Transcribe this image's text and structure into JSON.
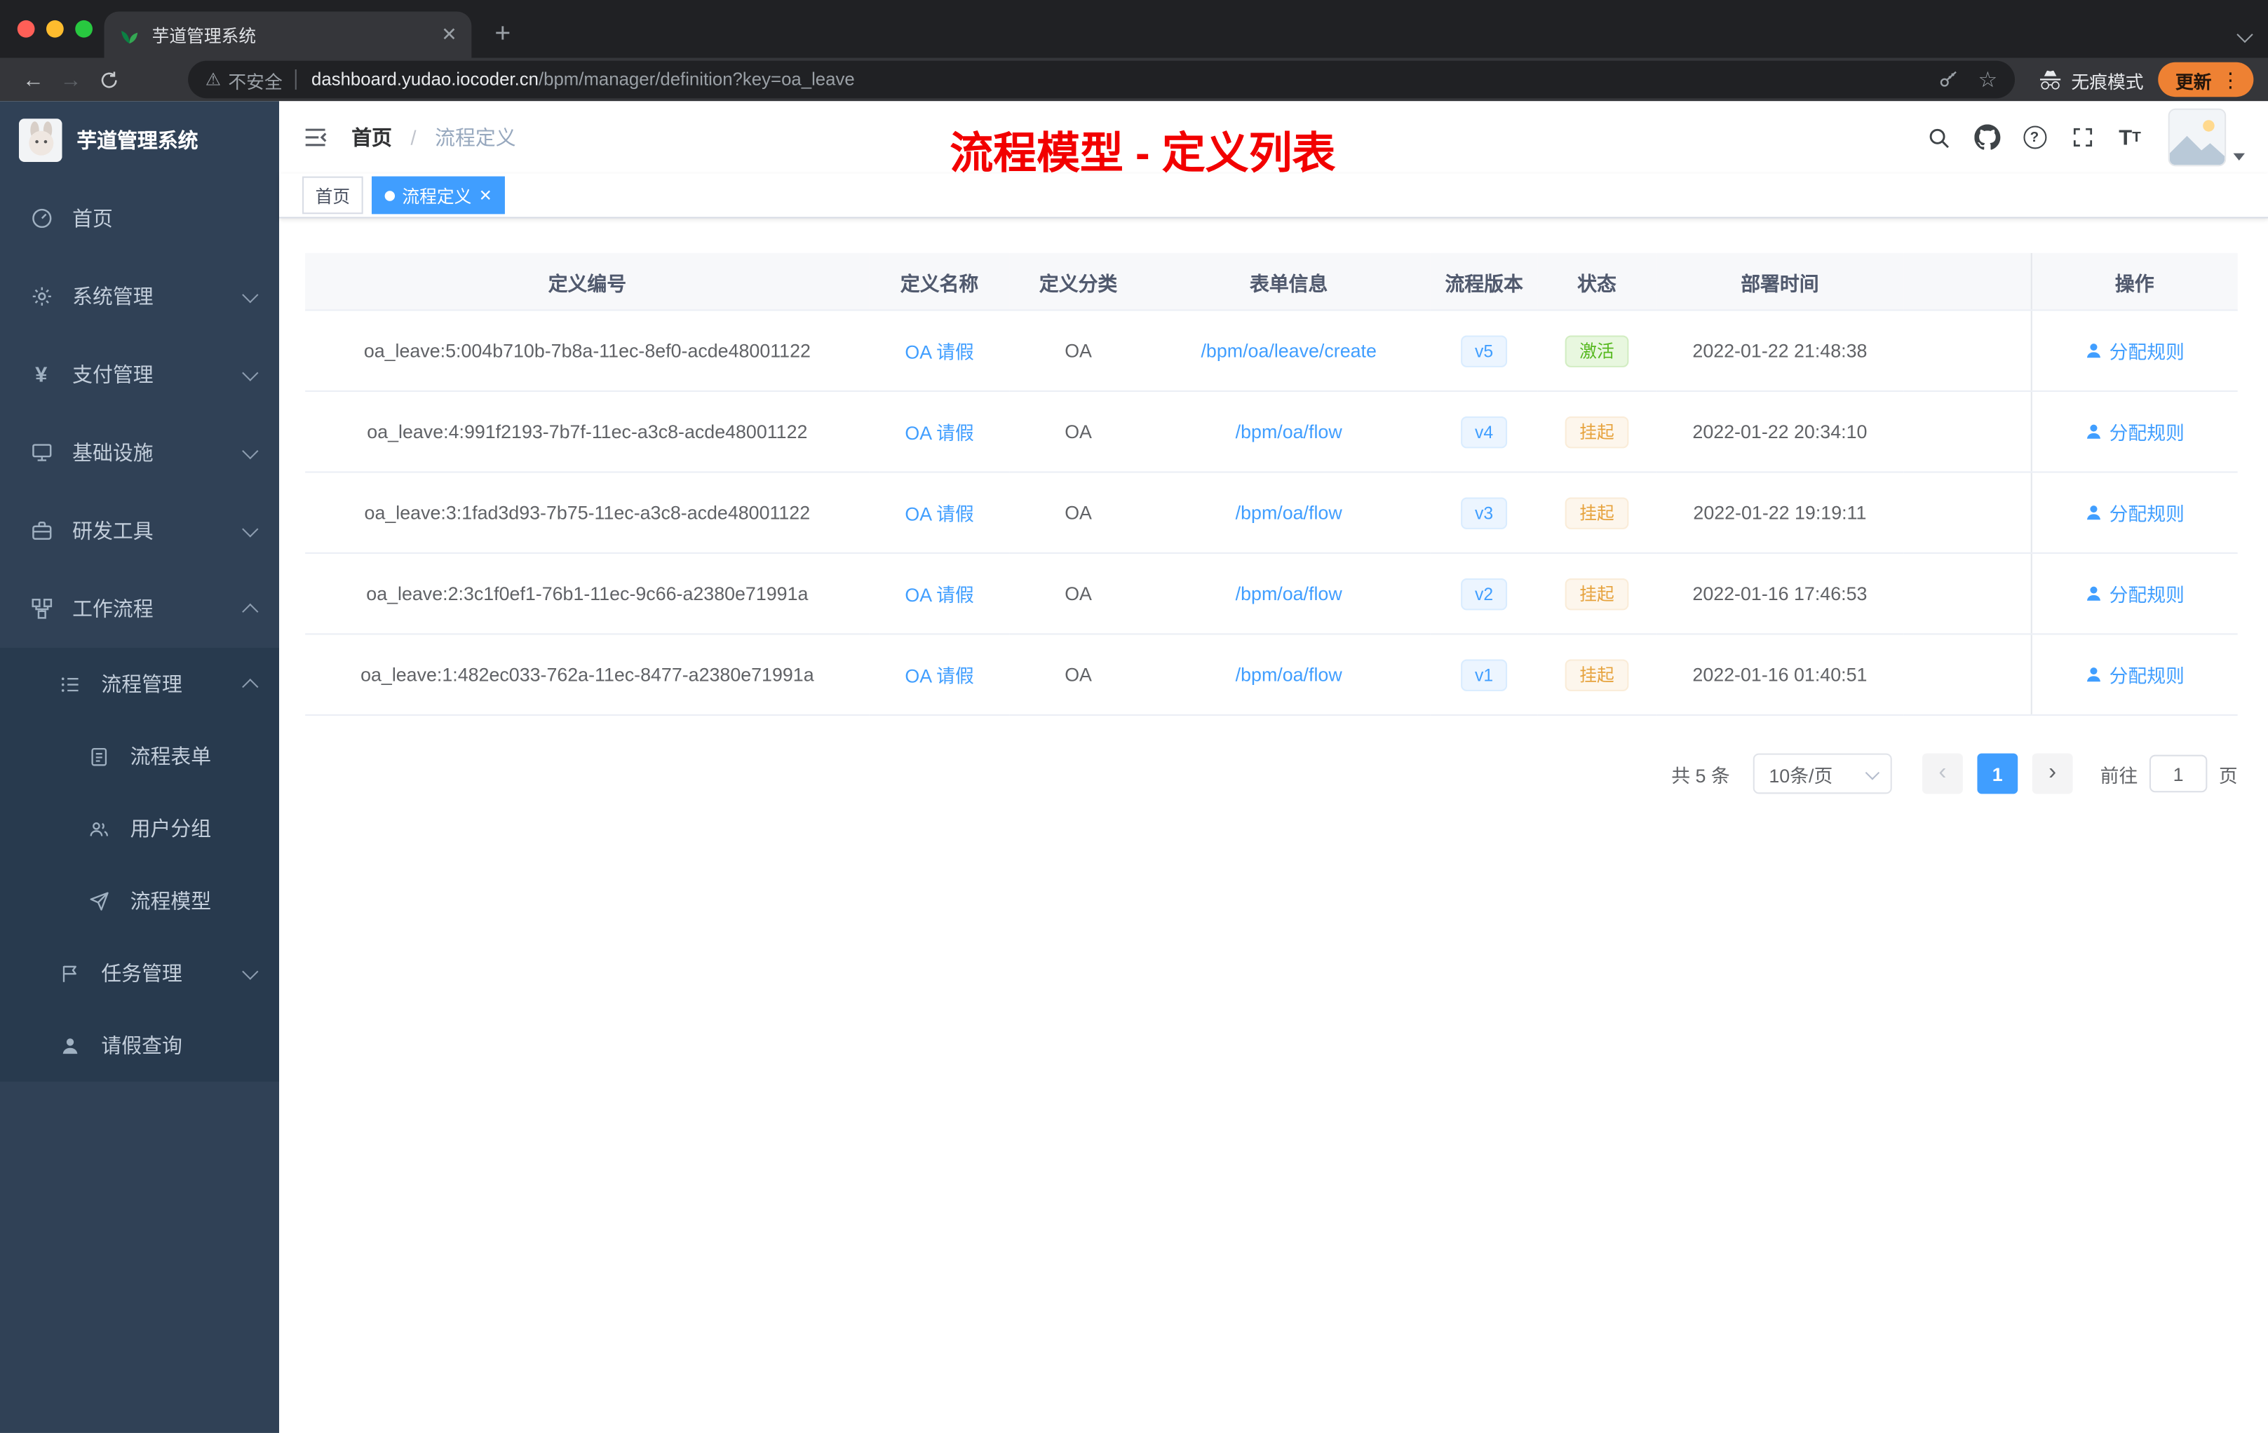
{
  "browser": {
    "tab_title": "芋道管理系统",
    "security_label": "不安全",
    "url_host": "dashboard.yudao.iocoder.cn",
    "url_path": "/bpm/manager/definition?key=oa_leave",
    "incognito_label": "无痕模式",
    "update_label": "更新"
  },
  "sidebar": {
    "logo_title": "芋道管理系统",
    "menu": [
      {
        "label": "首页",
        "icon": "dashboard-icon"
      },
      {
        "label": "系统管理",
        "icon": "gear-icon"
      },
      {
        "label": "支付管理",
        "icon": "yen-icon"
      },
      {
        "label": "基础设施",
        "icon": "infrastructure-icon"
      },
      {
        "label": "研发工具",
        "icon": "tools-icon"
      },
      {
        "label": "工作流程",
        "icon": "workflow-icon"
      },
      {
        "label": "流程管理",
        "icon": "process-list-icon"
      },
      {
        "label": "流程表单",
        "icon": "form-icon"
      },
      {
        "label": "用户分组",
        "icon": "user-group-icon"
      },
      {
        "label": "流程模型",
        "icon": "send-icon"
      },
      {
        "label": "任务管理",
        "icon": "flag-icon"
      },
      {
        "label": "请假查询",
        "icon": "person-icon"
      }
    ]
  },
  "header": {
    "breadcrumb": [
      "首页",
      "流程定义"
    ],
    "annotation": "流程模型 - 定义列表"
  },
  "tags": [
    {
      "label": "首页"
    },
    {
      "label": "流程定义"
    }
  ],
  "table": {
    "columns": [
      "定义编号",
      "定义名称",
      "定义分类",
      "表单信息",
      "流程版本",
      "状态",
      "部署时间",
      "操作"
    ],
    "rows": [
      {
        "id": "oa_leave:5:004b710b-7b8a-11ec-8ef0-acde48001122",
        "name": "OA 请假",
        "category": "OA",
        "form": "/bpm/oa/leave/create",
        "version": "v5",
        "status": "激活",
        "status_type": "success",
        "deploy_time": "2022-01-22 21:48:38",
        "action": "分配规则"
      },
      {
        "id": "oa_leave:4:991f2193-7b7f-11ec-a3c8-acde48001122",
        "name": "OA 请假",
        "category": "OA",
        "form": "/bpm/oa/flow",
        "version": "v4",
        "status": "挂起",
        "status_type": "warning",
        "deploy_time": "2022-01-22 20:34:10",
        "action": "分配规则"
      },
      {
        "id": "oa_leave:3:1fad3d93-7b75-11ec-a3c8-acde48001122",
        "name": "OA 请假",
        "category": "OA",
        "form": "/bpm/oa/flow",
        "version": "v3",
        "status": "挂起",
        "status_type": "warning",
        "deploy_time": "2022-01-22 19:19:11",
        "action": "分配规则"
      },
      {
        "id": "oa_leave:2:3c1f0ef1-76b1-11ec-9c66-a2380e71991a",
        "name": "OA 请假",
        "category": "OA",
        "form": "/bpm/oa/flow",
        "version": "v2",
        "status": "挂起",
        "status_type": "warning",
        "deploy_time": "2022-01-16 17:46:53",
        "action": "分配规则"
      },
      {
        "id": "oa_leave:1:482ec033-762a-11ec-8477-a2380e71991a",
        "name": "OA 请假",
        "category": "OA",
        "form": "/bpm/oa/flow",
        "version": "v1",
        "status": "挂起",
        "status_type": "warning",
        "deploy_time": "2022-01-16 01:40:51",
        "action": "分配规则"
      }
    ]
  },
  "pagination": {
    "total_label": "共 5 条",
    "page_size": "10条/页",
    "current_page": "1",
    "goto_label": "前往",
    "goto_value": "1",
    "unit_label": "页"
  },
  "colors": {
    "accent": "#409eff",
    "success": "#55b81e",
    "warning": "#e6a23c",
    "annotation_red": "#f20000",
    "sidebar_bg": "#304156"
  }
}
